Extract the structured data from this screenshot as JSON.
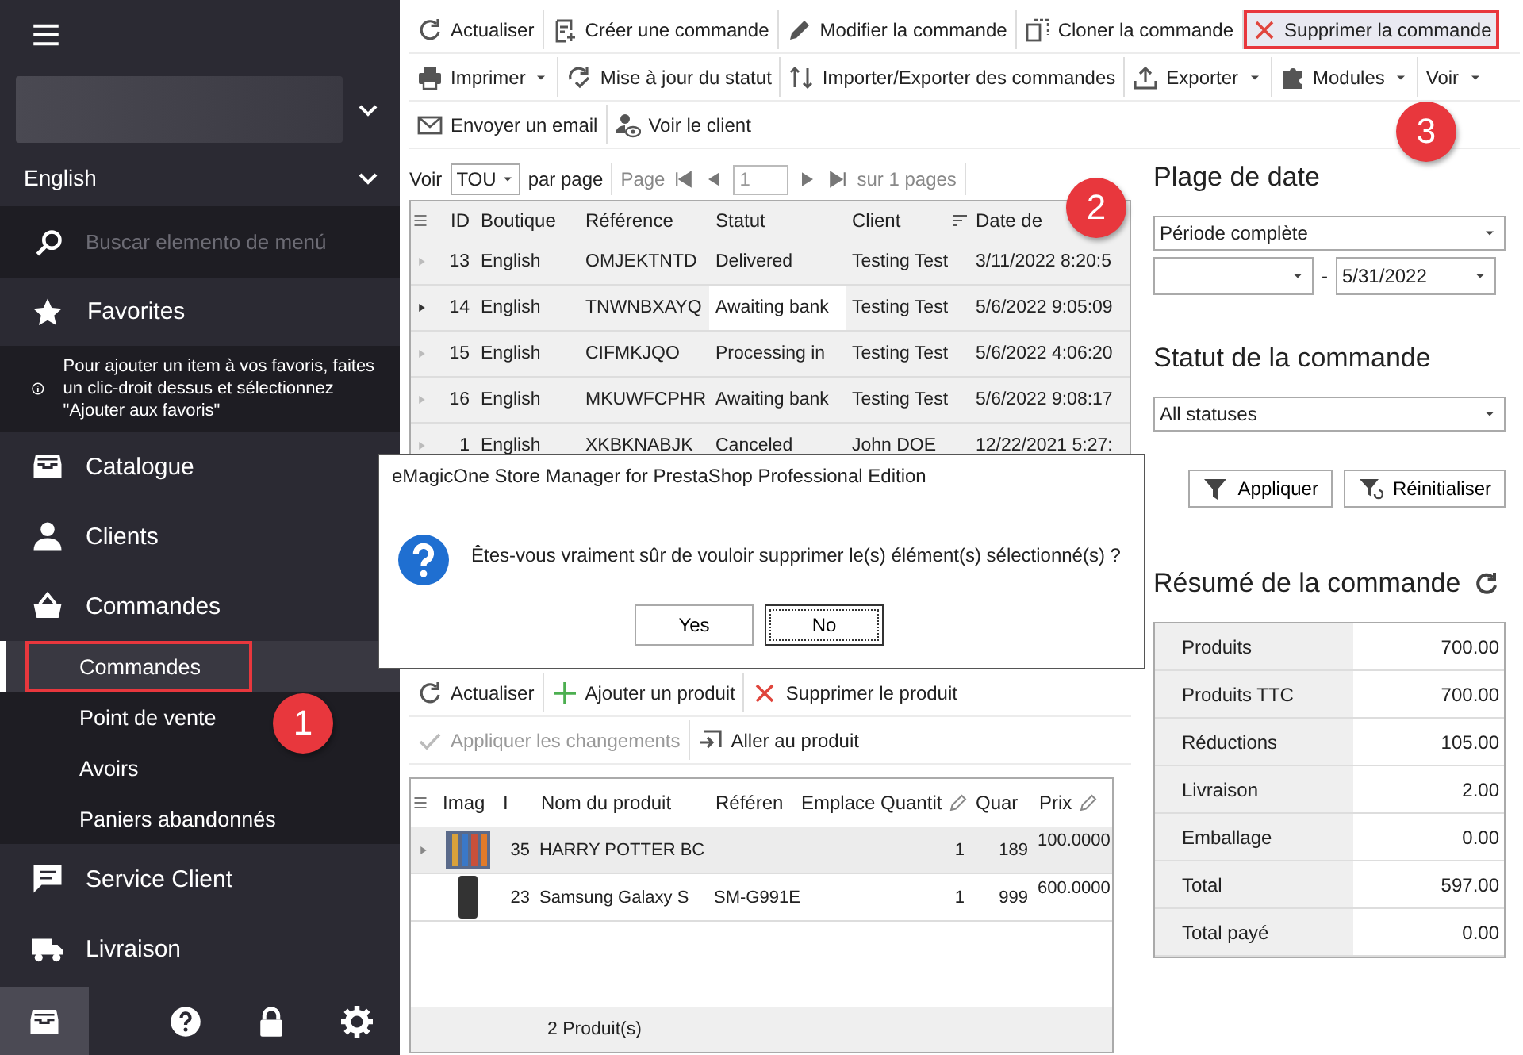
{
  "sidebar": {
    "language": "English",
    "search": {
      "placeholder": "Buscar elemento de menú"
    },
    "favorites": {
      "label": "Favorites",
      "hint": "Pour ajouter un item à vos favoris, faites un clic-droit dessus et sélectionnez \"Ajouter aux favoris\""
    },
    "items": [
      {
        "label": "Catalogue"
      },
      {
        "label": "Clients"
      },
      {
        "label": "Commandes",
        "children": [
          {
            "label": "Commandes",
            "selected": true,
            "highlighted": true
          },
          {
            "label": "Point de vente",
            "selected": false,
            "highlighted": false
          },
          {
            "label": "Avoirs",
            "selected": false,
            "highlighted": false
          },
          {
            "label": "Paniers abandonnés",
            "selected": false,
            "highlighted": false
          }
        ]
      },
      {
        "label": "Service Client"
      },
      {
        "label": "Livraison"
      }
    ],
    "bottom_bar": [
      {
        "selected": true
      },
      {
        "selected": false
      },
      {
        "selected": false
      },
      {
        "selected": false
      }
    ]
  },
  "toolbar": [
    [
      {
        "label": "Actualiser",
        "dropdown": false,
        "highlighted": false
      },
      {
        "label": "Créer une commande",
        "dropdown": false,
        "highlighted": false
      },
      {
        "label": "Modifier la commande",
        "dropdown": false,
        "highlighted": false
      },
      {
        "label": "Cloner la commande",
        "dropdown": false,
        "highlighted": false
      },
      {
        "label": "Supprimer la commande",
        "dropdown": false,
        "highlighted": true
      }
    ],
    [
      {
        "label": "Imprimer",
        "dropdown": true,
        "highlighted": false
      },
      {
        "label": "Mise à jour du statut",
        "dropdown": false,
        "highlighted": false
      },
      {
        "label": "Importer/Exporter des commandes",
        "dropdown": false,
        "highlighted": false
      },
      {
        "label": "Exporter",
        "dropdown": true,
        "highlighted": false
      },
      {
        "label": "Modules",
        "dropdown": true,
        "highlighted": false
      },
      {
        "label": "Voir",
        "dropdown": true,
        "highlighted": false
      }
    ],
    [
      {
        "label": "Envoyer un email",
        "dropdown": false,
        "highlighted": false
      },
      {
        "label": "Voir le client",
        "dropdown": false,
        "highlighted": false
      }
    ]
  ],
  "paging": {
    "per_page_label": "Voir",
    "per_page": "TOU",
    "per_page_suffix": "par page",
    "page_label": "Page",
    "page": "1",
    "page_total": "sur 1 pages"
  },
  "orders": {
    "columns": [
      "ID",
      "Boutique",
      "Référence",
      "Statut",
      "Client",
      "Date de"
    ],
    "rows": [
      {
        "selected": false,
        "cells": [
          "13",
          "English",
          "OMJEKTNTD",
          "Delivered",
          "Testing Test",
          "3/11/2022 8:20:5"
        ]
      },
      {
        "selected": true,
        "cells": [
          "14",
          "English",
          "TNWNBXAYQ",
          "Awaiting bank",
          "Testing Test",
          "5/6/2022 9:05:09"
        ]
      },
      {
        "selected": false,
        "cells": [
          "15",
          "English",
          "CIFMKJQO",
          "Processing in",
          "Testing Test",
          "5/6/2022 4:06:20"
        ]
      },
      {
        "selected": false,
        "cells": [
          "16",
          "English",
          "MKUWFCPHR",
          "Awaiting bank",
          "Testing Test",
          "5/6/2022 9:08:17"
        ]
      },
      {
        "selected": false,
        "cells": [
          "1",
          "English",
          "XKBKNABJK",
          "Canceled",
          "John DOE",
          "12/22/2021 5:27:"
        ]
      }
    ]
  },
  "filters": {
    "date_range": {
      "title": "Plage de date",
      "period": "Période complète",
      "separator": "-",
      "to": "5/31/2022"
    },
    "status": {
      "title": "Statut de la commande",
      "value": "All statuses"
    },
    "buttons": [
      "Appliquer",
      "Réinitialiser"
    ]
  },
  "summary": {
    "title": "Résumé de la commande",
    "rows": [
      {
        "label": "Produits",
        "value": "700.00"
      },
      {
        "label": "Produits TTC",
        "value": "700.00"
      },
      {
        "label": "Réductions",
        "value": "105.00"
      },
      {
        "label": "Livraison",
        "value": "2.00"
      },
      {
        "label": "Emballage",
        "value": "0.00"
      },
      {
        "label": "Total",
        "value": "597.00"
      },
      {
        "label": "Total payé",
        "value": "0.00"
      }
    ]
  },
  "dialog": {
    "title": "eMagicOne Store Manager for PrestaShop Professional Edition",
    "message": "Êtes-vous vraiment sûr de vouloir supprimer le(s) élément(s) sélectionné(s) ?",
    "buttons": [
      {
        "label": "Yes",
        "focused": false
      },
      {
        "label": "No",
        "focused": true
      }
    ]
  },
  "product_toolbar": [
    [
      {
        "label": "Actualiser",
        "disabled": false
      },
      {
        "label": "Ajouter un produit",
        "disabled": false
      },
      {
        "label": "Supprimer le produit",
        "disabled": false
      }
    ],
    [
      {
        "label": "Appliquer les changements",
        "disabled": true
      },
      {
        "label": "Aller au produit",
        "disabled": false
      }
    ]
  ],
  "products": {
    "columns": [
      {
        "label": "Imag",
        "editable": false
      },
      {
        "label": "I",
        "editable": false
      },
      {
        "label": "Nom du produit",
        "editable": false
      },
      {
        "label": "Référen",
        "editable": false
      },
      {
        "label": "Emplace",
        "editable": false
      },
      {
        "label": "Quantit",
        "editable": true
      },
      {
        "label": "Quar",
        "editable": false
      },
      {
        "label": "Prix",
        "editable": true
      }
    ],
    "rows": [
      {
        "selected": true,
        "id": "35",
        "name": "HARRY POTTER BC",
        "quantity": "1",
        "column_7": "189",
        "price": "100.0000"
      },
      {
        "selected": false,
        "id": "23",
        "name": "Samsung Galaxy S",
        "reference": "SM-G991E",
        "quantity": "1",
        "column_7": "999",
        "price": "600.0000"
      }
    ],
    "count": "2 Produit(s)"
  },
  "annotations": [
    {
      "number": "1"
    },
    {
      "number": "2"
    },
    {
      "number": "3"
    }
  ]
}
